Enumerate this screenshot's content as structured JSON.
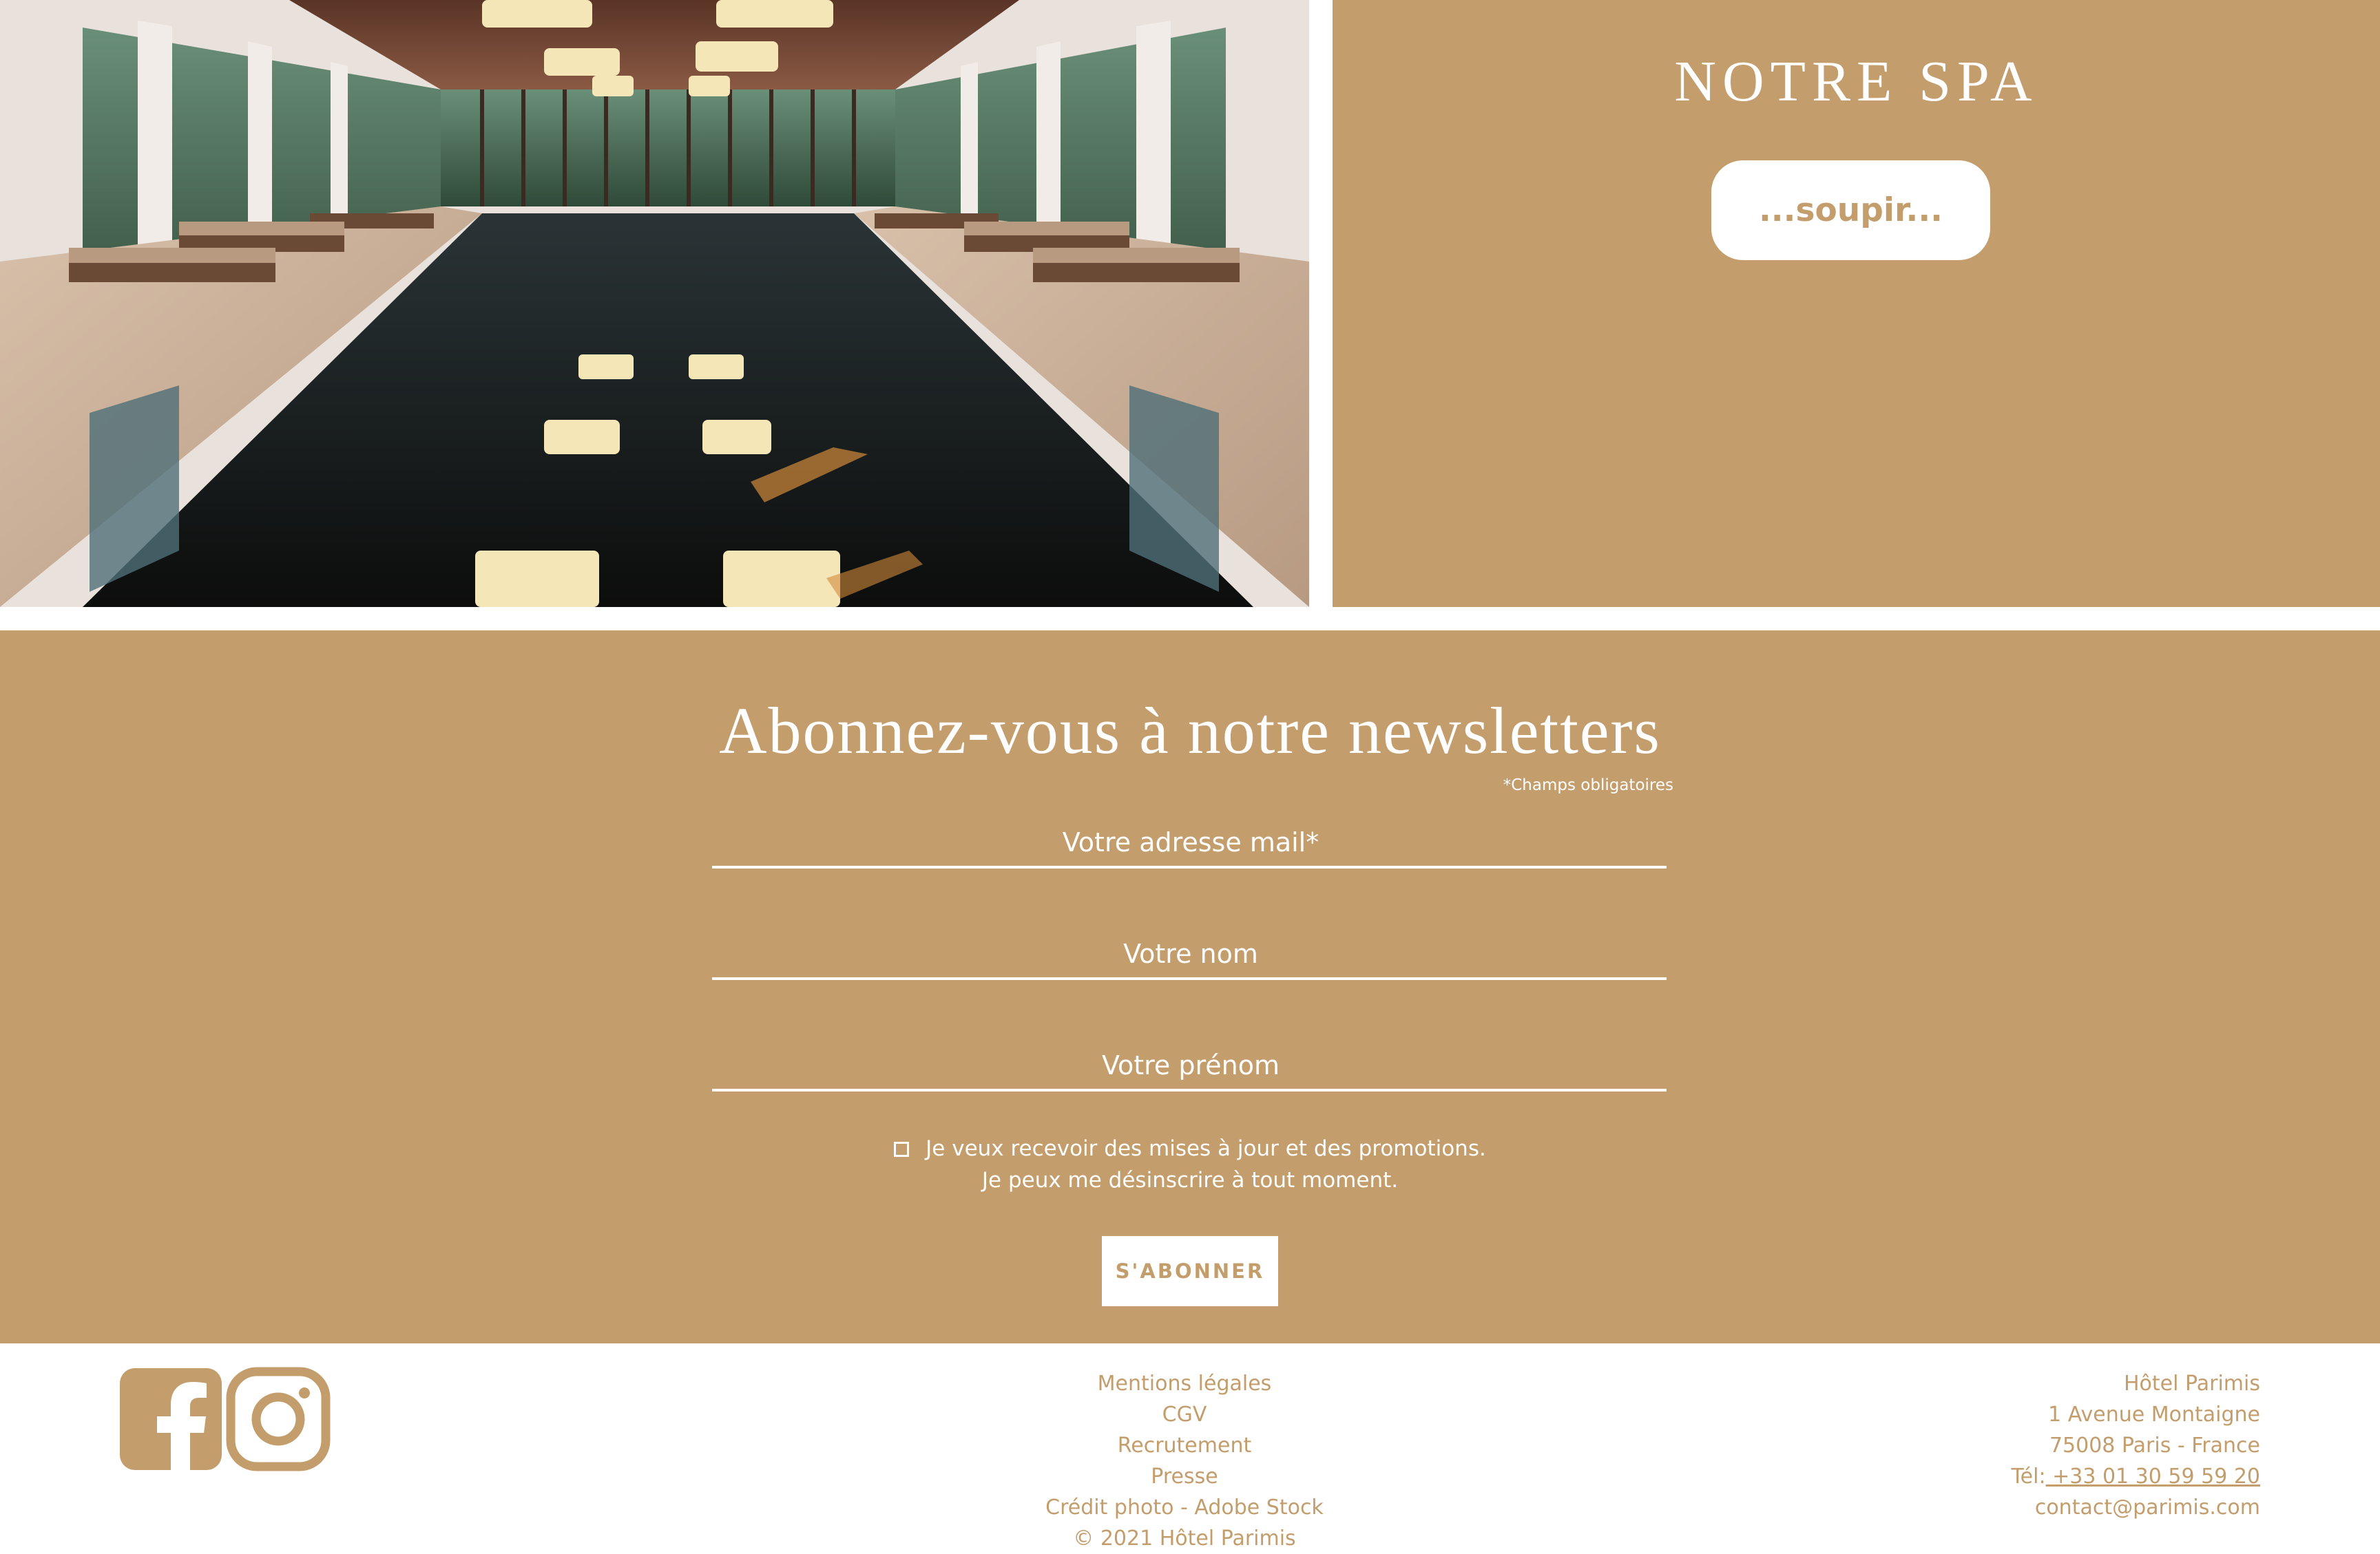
{
  "spa": {
    "title": "NOTRE SPA",
    "button_label": "...soupir..."
  },
  "newsletter": {
    "title": "Abonnez-vous à notre newsletters",
    "required_note": "*Champs obligatoires",
    "email_placeholder": "Votre adresse mail*",
    "nom_placeholder": "Votre nom",
    "prenom_placeholder": "Votre prénom",
    "consent_line1": "Je veux recevoir des mises à jour et des promotions.",
    "consent_line2": "Je peux me désinscrire à tout moment.",
    "submit_label": "S'ABONNER"
  },
  "footer": {
    "links": [
      "Mentions légales",
      "CGV",
      "Recrutement",
      "Presse",
      "Crédit photo - Adobe Stock",
      "© 2021 Hôtel Parimis"
    ],
    "hotel_name": "Hôtel Parimis",
    "address_line1": "1 Avenue Montaigne",
    "address_line2": "75008 Paris - France",
    "phone_label": "Tél:",
    "phone": " +33 01 30 59 59 20",
    "email": "contact@parimis.com",
    "social_icons": [
      "facebook-icon",
      "instagram-icon"
    ]
  },
  "colors": {
    "brand_gold": "#c39d6b",
    "white": "#ffffff"
  }
}
